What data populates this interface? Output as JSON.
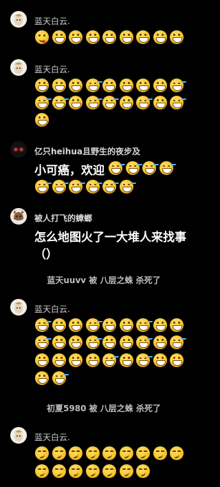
{
  "messages": [
    {
      "user": "蓝天白云.",
      "avatar": "cloud-avatar",
      "rows": [
        [
          "yum",
          "grin",
          "grin",
          "grin",
          "grin",
          "grin",
          "grin",
          "grin",
          "grin"
        ]
      ]
    },
    {
      "user": "蓝天白云.",
      "avatar": "cloud-avatar",
      "rows": [
        [
          "grin",
          "grin",
          "grin",
          "sweat",
          "grin",
          "grin",
          "grin",
          "grin",
          "sweat"
        ],
        [
          "sweat",
          "sweat",
          "grin",
          "sweat",
          "sweat",
          "grin",
          "sweat",
          "grin",
          "sweat"
        ],
        [
          "grin"
        ]
      ]
    },
    {
      "user": "亿只heihua且野生的夜步及",
      "avatar": "mask-avatar",
      "text": "小可癌，欢迎",
      "rows_after_text": [
        [
          "sweat",
          "sweat",
          "sweat",
          "sweat"
        ]
      ],
      "rows": [
        [
          "sweat",
          "sweat",
          "sweat",
          "sweat",
          "sweat",
          "sweat",
          "sweat",
          "sweat",
          "sweat"
        ]
      ]
    },
    {
      "user": "被人打飞的蟑螂",
      "avatar": "cat-avatar",
      "text_line1": "怎么地图火了一大堆人来找事",
      "text_line2": "（）"
    },
    {
      "system": "蓝天uuvv 被 八层之蛛 杀死了"
    },
    {
      "user": "蓝天白云.",
      "avatar": "cloud-avatar",
      "rows": [
        [
          "sweat",
          "grin",
          "grin",
          "sweat",
          "grin",
          "grin",
          "sweat",
          "grin",
          "grin"
        ],
        [
          "sweat",
          "grin",
          "grin",
          "sweat",
          "grin",
          "grin",
          "sweat",
          "grin",
          "sweat"
        ],
        [
          "grin",
          "grin",
          "grin",
          "grin",
          "sweat",
          "grin",
          "sweat",
          "grin",
          "grin"
        ],
        [
          "grin",
          "sweat"
        ]
      ]
    },
    {
      "system": "初夏5980 被 八层之蛛 杀死了"
    },
    {
      "user": "蓝天白云.",
      "avatar": "cloud-avatar",
      "rows": [
        [
          "smirk",
          "smirk",
          "smirk",
          "smirk",
          "smirk",
          "smirk",
          "smirk",
          "smirk",
          "smirk"
        ],
        [
          "smirk",
          "smirk",
          "smirk",
          "smirk",
          "smirk",
          "smirk",
          "smirk"
        ]
      ]
    }
  ]
}
